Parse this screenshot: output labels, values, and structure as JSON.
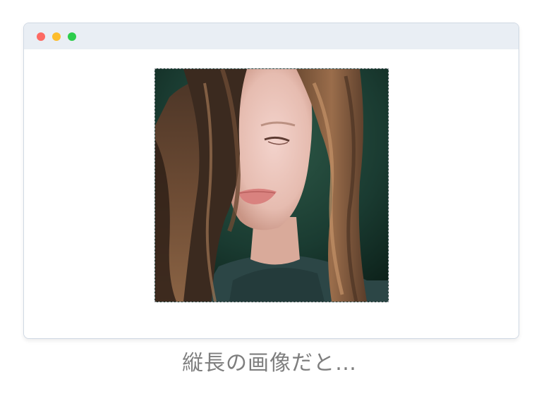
{
  "window": {
    "controls": [
      {
        "name": "close",
        "color": "#fd6a63"
      },
      {
        "name": "minimize",
        "color": "#fdbd2d"
      },
      {
        "name": "zoom",
        "color": "#2ccd4c"
      }
    ]
  },
  "caption": {
    "text": "縦長の画像だと…",
    "color": "#7e7e7e"
  }
}
